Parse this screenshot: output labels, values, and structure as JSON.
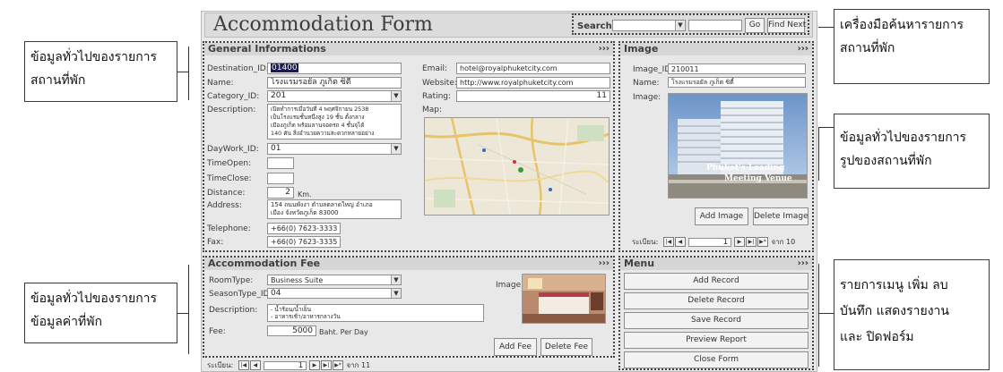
{
  "app": {
    "title": "Accommodation Form"
  },
  "search": {
    "label": "Search:",
    "go_label": "Go",
    "findnext_label": "Find Next"
  },
  "general": {
    "title": "General Informations",
    "more": "›››",
    "labels": {
      "destination_id": "Destination_ID:",
      "name": "Name:",
      "category_id": "Category_ID:",
      "description": "Description:",
      "daywork_id": "DayWork_ID:",
      "timeopen": "TimeOpen:",
      "timeclose": "TimeClose:",
      "distance": "Distance:",
      "address": "Address:",
      "telephone": "Telephone:",
      "fax": "Fax:",
      "email": "Email:",
      "website": "Website:",
      "rating": "Rating:",
      "map": "Map:"
    },
    "values": {
      "destination_id": "01400",
      "name": "โรงแรมรอยัล ภูเก็ต ซิตี้",
      "category_id": "201",
      "description": [
        "เปิดทำการเมื่อวันที่ 4 พฤศจิกายน 2538",
        "เป็นโรงแรมชั้นหนึ่งสูง 19 ชั้น ตั้งกลาง",
        "เมืองภูเก็ต พร้อมลานจอดรถ 4 ชั้นจุได้",
        "140 คัน สิ่งอำนวยความสะดวกหลายอย่าง"
      ],
      "daywork_id": "01",
      "timeopen": "",
      "timeclose": "",
      "distance": "2",
      "distance_unit": "Km.",
      "address": [
        "154 ถนนพังงา ตำบลตลาดใหญ่ อำเภอ",
        "เมือง จังหวัดภูเก็ต 83000"
      ],
      "telephone": "+66(0) 7623-3333",
      "fax": "+66(0) 7623-3335",
      "email": "hotel@royalphuketcity.com",
      "website": "http://www.royalphuketcity.com",
      "rating": "11"
    }
  },
  "image": {
    "title": "Image",
    "more": "›››",
    "labels": {
      "image_id": "Image_ID:",
      "name": "Name:",
      "image": "Image:"
    },
    "values": {
      "image_id": "210011",
      "name": "โรงแรมรอยัล ภูเก็ต ซิตี้"
    },
    "photo_caption": [
      "Phuket's Leading",
      "Meeting Venue"
    ],
    "add_label": "Add Image",
    "delete_label": "Delete Image",
    "nav": {
      "prefix": "ระเบียน:",
      "current": "1",
      "suffix": "จาก 10"
    }
  },
  "fee": {
    "title": "Accommodation Fee",
    "more": "›››",
    "labels": {
      "roomtype": "RoomType:",
      "seasontype_id": "SeasonType_ID:",
      "description": "Description:",
      "fee": "Fee:",
      "image": "Image:"
    },
    "values": {
      "roomtype": "Business Suite",
      "seasontype_id": "04",
      "description": [
        "- น้ำร้อน/น้ำเย็น",
        "- อาหารเช้า/อาหารกลางวัน"
      ],
      "fee": "5000",
      "fee_unit": "Baht. Per Day"
    },
    "add_label": "Add Fee",
    "delete_label": "Delete Fee",
    "nav": {
      "prefix": "ระเบียน:",
      "current": "1",
      "suffix": "จาก 11"
    }
  },
  "menu": {
    "title": "Menu",
    "more": "›››",
    "items": [
      "Add Record",
      "Delete Record",
      "Save Record",
      "Preview Report",
      "Close Form"
    ]
  },
  "annotations": {
    "left_general": [
      "ข้อมูลทั่วไปของรายการ",
      "สถานที่พัก"
    ],
    "left_fee": [
      "ข้อมูลทั่วไปของรายการ",
      "ข้อมูลค่าที่พัก"
    ],
    "right_search": [
      "เครื่องมือค้นหารายการ",
      "สถานที่พัก"
    ],
    "right_image": [
      "ข้อมูลทั่วไปของรายการ",
      "รูปของสถานที่พัก"
    ],
    "right_menu": [
      "รายการเมนู เพิ่ม ลบ",
      "บันทึก แสดงรายงาน",
      "และ ปิดฟอร์ม"
    ]
  },
  "colors": {
    "form_bg": "#e8e8e8",
    "section_header": "#d6d6d6",
    "annotation_border": "#3a3a3a"
  }
}
